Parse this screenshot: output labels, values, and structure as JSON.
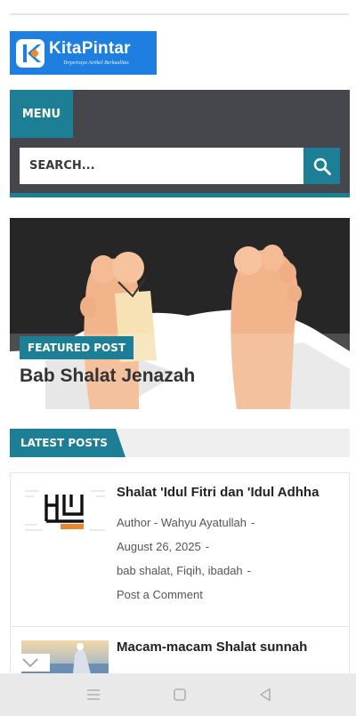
{
  "site": {
    "logo_name": "KitaPintar",
    "logo_tagline": "Terpercaya Artikel Berkualitas",
    "brand_color": "#1f7fe0",
    "accent_color": "#1d7f95"
  },
  "nav": {
    "menu_label": "MENU",
    "search_placeholder": "SEARCH...",
    "search_icon": "search-icon"
  },
  "featured": {
    "badge": "FEATURED POST",
    "title": "Bab Shalat Jenazah"
  },
  "latest": {
    "label": "LATEST POSTS",
    "posts": [
      {
        "title": "Shalat 'Idul Fitri dan 'Idul Adhha",
        "author": "Author - Wahyu Ayatullah",
        "date": "August 26, 2025",
        "labels": "bab shalat, Fiqih, ibadah",
        "comment": "Post a Comment",
        "separator": "-"
      },
      {
        "title": "Macam-macam Shalat sunnah"
      }
    ]
  },
  "system_nav": {
    "icons": [
      "menu-icon",
      "home-square-icon",
      "back-triangle-icon"
    ]
  }
}
